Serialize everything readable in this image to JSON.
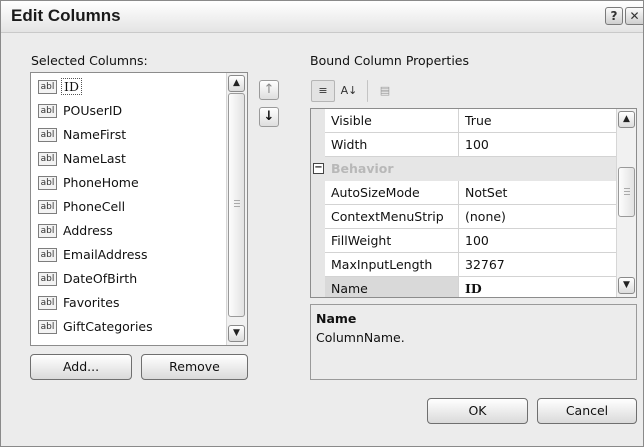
{
  "window": {
    "title": "Edit Columns",
    "help_glyph": "?",
    "close_glyph": "✕"
  },
  "selected_columns": {
    "label": "Selected Columns:",
    "icon_text": "abl",
    "items": [
      "ID",
      "POUserID",
      "NameFirst",
      "NameLast",
      "PhoneHome",
      "PhoneCell",
      "Address",
      "EmailAddress",
      "DateOfBirth",
      "Favorites",
      "GiftCategories"
    ],
    "selected_index": 0
  },
  "move": {
    "up_glyph": "↑",
    "down_glyph": "↓"
  },
  "buttons": {
    "add": "Add...",
    "remove": "Remove",
    "ok": "OK",
    "cancel": "Cancel"
  },
  "properties": {
    "label": "Bound Column Properties",
    "toolbar": {
      "categorized": "≡",
      "alphabetical": "A↓",
      "pages": "▤"
    },
    "rows": [
      {
        "name": "Visible",
        "value": "True"
      },
      {
        "name": "Width",
        "value": "100"
      }
    ],
    "category": {
      "toggle": "−",
      "name": "Behavior"
    },
    "behavior_rows": [
      {
        "name": "AutoSizeMode",
        "value": "NotSet"
      },
      {
        "name": "ContextMenuStrip",
        "value": "(none)"
      },
      {
        "name": "FillWeight",
        "value": "100"
      },
      {
        "name": "MaxInputLength",
        "value": "32767"
      },
      {
        "name": "Name",
        "value": "ID"
      }
    ],
    "description": {
      "title": "Name",
      "text": "ColumnName."
    }
  },
  "scroll_glyphs": {
    "up": "▲",
    "down": "▼"
  }
}
